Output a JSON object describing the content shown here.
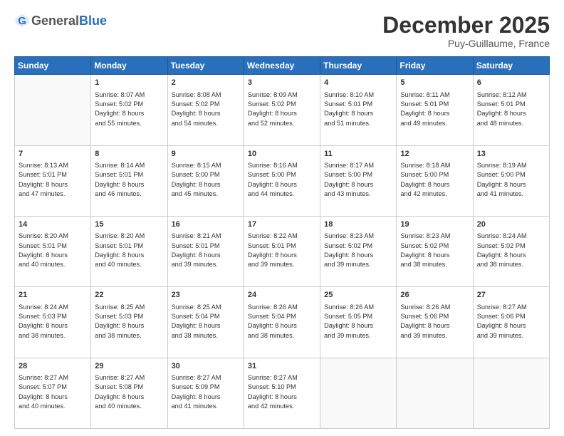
{
  "logo": {
    "general": "General",
    "blue": "Blue"
  },
  "header": {
    "month": "December 2025",
    "location": "Puy-Guillaume, France"
  },
  "days": [
    "Sunday",
    "Monday",
    "Tuesday",
    "Wednesday",
    "Thursday",
    "Friday",
    "Saturday"
  ],
  "weeks": [
    [
      {
        "day": "",
        "sunrise": "",
        "sunset": "",
        "daylight": ""
      },
      {
        "day": "1",
        "sunrise": "Sunrise: 8:07 AM",
        "sunset": "Sunset: 5:02 PM",
        "daylight": "Daylight: 8 hours and 55 minutes."
      },
      {
        "day": "2",
        "sunrise": "Sunrise: 8:08 AM",
        "sunset": "Sunset: 5:02 PM",
        "daylight": "Daylight: 8 hours and 54 minutes."
      },
      {
        "day": "3",
        "sunrise": "Sunrise: 8:09 AM",
        "sunset": "Sunset: 5:02 PM",
        "daylight": "Daylight: 8 hours and 52 minutes."
      },
      {
        "day": "4",
        "sunrise": "Sunrise: 8:10 AM",
        "sunset": "Sunset: 5:01 PM",
        "daylight": "Daylight: 8 hours and 51 minutes."
      },
      {
        "day": "5",
        "sunrise": "Sunrise: 8:11 AM",
        "sunset": "Sunset: 5:01 PM",
        "daylight": "Daylight: 8 hours and 49 minutes."
      },
      {
        "day": "6",
        "sunrise": "Sunrise: 8:12 AM",
        "sunset": "Sunset: 5:01 PM",
        "daylight": "Daylight: 8 hours and 48 minutes."
      }
    ],
    [
      {
        "day": "7",
        "sunrise": "Sunrise: 8:13 AM",
        "sunset": "Sunset: 5:01 PM",
        "daylight": "Daylight: 8 hours and 47 minutes."
      },
      {
        "day": "8",
        "sunrise": "Sunrise: 8:14 AM",
        "sunset": "Sunset: 5:01 PM",
        "daylight": "Daylight: 8 hours and 46 minutes."
      },
      {
        "day": "9",
        "sunrise": "Sunrise: 8:15 AM",
        "sunset": "Sunset: 5:00 PM",
        "daylight": "Daylight: 8 hours and 45 minutes."
      },
      {
        "day": "10",
        "sunrise": "Sunrise: 8:16 AM",
        "sunset": "Sunset: 5:00 PM",
        "daylight": "Daylight: 8 hours and 44 minutes."
      },
      {
        "day": "11",
        "sunrise": "Sunrise: 8:17 AM",
        "sunset": "Sunset: 5:00 PM",
        "daylight": "Daylight: 8 hours and 43 minutes."
      },
      {
        "day": "12",
        "sunrise": "Sunrise: 8:18 AM",
        "sunset": "Sunset: 5:00 PM",
        "daylight": "Daylight: 8 hours and 42 minutes."
      },
      {
        "day": "13",
        "sunrise": "Sunrise: 8:19 AM",
        "sunset": "Sunset: 5:00 PM",
        "daylight": "Daylight: 8 hours and 41 minutes."
      }
    ],
    [
      {
        "day": "14",
        "sunrise": "Sunrise: 8:20 AM",
        "sunset": "Sunset: 5:01 PM",
        "daylight": "Daylight: 8 hours and 40 minutes."
      },
      {
        "day": "15",
        "sunrise": "Sunrise: 8:20 AM",
        "sunset": "Sunset: 5:01 PM",
        "daylight": "Daylight: 8 hours and 40 minutes."
      },
      {
        "day": "16",
        "sunrise": "Sunrise: 8:21 AM",
        "sunset": "Sunset: 5:01 PM",
        "daylight": "Daylight: 8 hours and 39 minutes."
      },
      {
        "day": "17",
        "sunrise": "Sunrise: 8:22 AM",
        "sunset": "Sunset: 5:01 PM",
        "daylight": "Daylight: 8 hours and 39 minutes."
      },
      {
        "day": "18",
        "sunrise": "Sunrise: 8:23 AM",
        "sunset": "Sunset: 5:02 PM",
        "daylight": "Daylight: 8 hours and 39 minutes."
      },
      {
        "day": "19",
        "sunrise": "Sunrise: 8:23 AM",
        "sunset": "Sunset: 5:02 PM",
        "daylight": "Daylight: 8 hours and 38 minutes."
      },
      {
        "day": "20",
        "sunrise": "Sunrise: 8:24 AM",
        "sunset": "Sunset: 5:02 PM",
        "daylight": "Daylight: 8 hours and 38 minutes."
      }
    ],
    [
      {
        "day": "21",
        "sunrise": "Sunrise: 8:24 AM",
        "sunset": "Sunset: 5:03 PM",
        "daylight": "Daylight: 8 hours and 38 minutes."
      },
      {
        "day": "22",
        "sunrise": "Sunrise: 8:25 AM",
        "sunset": "Sunset: 5:03 PM",
        "daylight": "Daylight: 8 hours and 38 minutes."
      },
      {
        "day": "23",
        "sunrise": "Sunrise: 8:25 AM",
        "sunset": "Sunset: 5:04 PM",
        "daylight": "Daylight: 8 hours and 38 minutes."
      },
      {
        "day": "24",
        "sunrise": "Sunrise: 8:26 AM",
        "sunset": "Sunset: 5:04 PM",
        "daylight": "Daylight: 8 hours and 38 minutes."
      },
      {
        "day": "25",
        "sunrise": "Sunrise: 8:26 AM",
        "sunset": "Sunset: 5:05 PM",
        "daylight": "Daylight: 8 hours and 39 minutes."
      },
      {
        "day": "26",
        "sunrise": "Sunrise: 8:26 AM",
        "sunset": "Sunset: 5:06 PM",
        "daylight": "Daylight: 8 hours and 39 minutes."
      },
      {
        "day": "27",
        "sunrise": "Sunrise: 8:27 AM",
        "sunset": "Sunset: 5:06 PM",
        "daylight": "Daylight: 8 hours and 39 minutes."
      }
    ],
    [
      {
        "day": "28",
        "sunrise": "Sunrise: 8:27 AM",
        "sunset": "Sunset: 5:07 PM",
        "daylight": "Daylight: 8 hours and 40 minutes."
      },
      {
        "day": "29",
        "sunrise": "Sunrise: 8:27 AM",
        "sunset": "Sunset: 5:08 PM",
        "daylight": "Daylight: 8 hours and 40 minutes."
      },
      {
        "day": "30",
        "sunrise": "Sunrise: 8:27 AM",
        "sunset": "Sunset: 5:09 PM",
        "daylight": "Daylight: 8 hours and 41 minutes."
      },
      {
        "day": "31",
        "sunrise": "Sunrise: 8:27 AM",
        "sunset": "Sunset: 5:10 PM",
        "daylight": "Daylight: 8 hours and 42 minutes."
      },
      {
        "day": "",
        "sunrise": "",
        "sunset": "",
        "daylight": ""
      },
      {
        "day": "",
        "sunrise": "",
        "sunset": "",
        "daylight": ""
      },
      {
        "day": "",
        "sunrise": "",
        "sunset": "",
        "daylight": ""
      }
    ]
  ]
}
